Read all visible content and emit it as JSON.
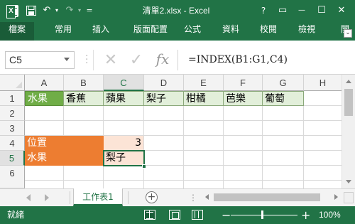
{
  "window": {
    "title": "清單2.xlsx - Excel",
    "help": "?",
    "ribbon_display": "▭",
    "minimize": "—",
    "maximize": "☐",
    "close": "✕"
  },
  "qat": {
    "save_icon": "save-icon",
    "undo": "↶",
    "redo": "↷",
    "customize": "="
  },
  "ribbon": {
    "tabs": [
      "檔案",
      "常用",
      "插入",
      "版面配置",
      "公式",
      "資料",
      "校閱",
      "檢視",
      "開"
    ]
  },
  "formula_bar": {
    "name_box": "C5",
    "cancel": "✕",
    "enter": "✓",
    "fx": "fx",
    "formula": "=INDEX(B1:G1,C4)"
  },
  "grid": {
    "columns": [
      "A",
      "B",
      "C",
      "D",
      "E",
      "F",
      "G",
      "H"
    ],
    "rows": [
      "1",
      "2",
      "3",
      "4",
      "5",
      "6"
    ],
    "cells": {
      "A1": "水果",
      "B1": "香蕉",
      "C1": "蘋果",
      "D1": "梨子",
      "E1": "柑橘",
      "F1": "芭樂",
      "G1": "葡萄",
      "A4": "位置",
      "C4": "3",
      "A5": "水果",
      "C5": "梨子"
    },
    "active_cell": "C5",
    "colors": {
      "header_green": "#70ad47",
      "fruit_fill": "#e2efda",
      "label_orange": "#ed7d31",
      "value_peach": "#fce4d6",
      "accent": "#217346"
    }
  },
  "sheets": {
    "tabs": [
      "工作表1"
    ],
    "active": "工作表1",
    "add": "+",
    "more": "⋮"
  },
  "status": {
    "mode": "就緒",
    "zoom_minus": "−",
    "zoom_plus": "+",
    "zoom": "100%"
  }
}
